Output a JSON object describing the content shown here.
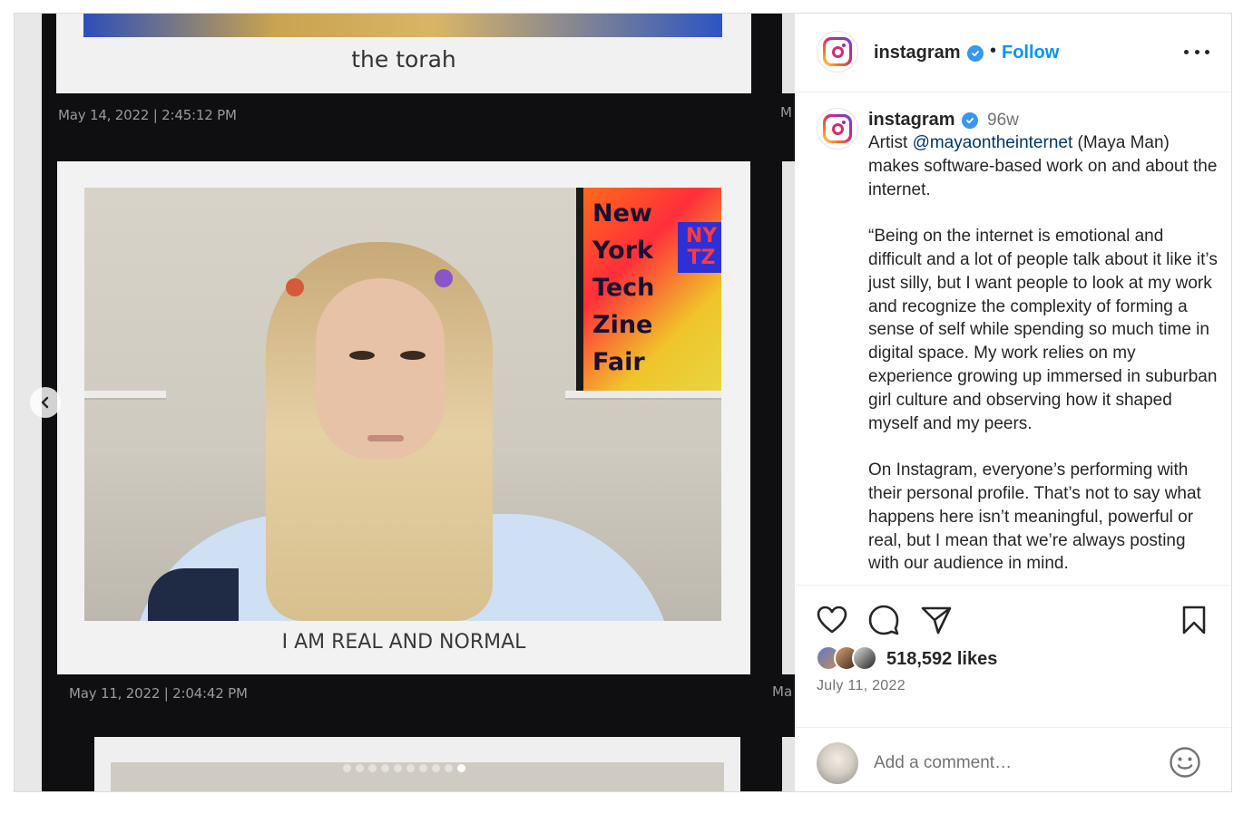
{
  "media": {
    "top_caption": "the torah",
    "timestamp_1": "May 14, 2022 | 2:45:12 PM",
    "cut_label_1": "M",
    "poster_text": "New\nYork\nTech\nZine\nFair",
    "poster_badge": "NY\nTZ",
    "main_caption": "I AM REAL AND NORMAL",
    "timestamp_2": "May 11, 2022 | 2:04:42 PM",
    "cut_label_2": "Ma",
    "prev_icon": "chevron-left-icon",
    "slide_count": 10,
    "active_slide": 10
  },
  "header": {
    "username": "instagram",
    "separator": "•",
    "follow_label": "Follow",
    "more_icon": "more-horizontal-icon"
  },
  "caption": {
    "username": "instagram",
    "time_ago": "96w",
    "text_before_mention": "Artist ",
    "mention": "@mayaontheinternet",
    "text_after_mention": " (Maya Man) makes software-based work on and about the internet.\n\n“Being on the internet is emotional and difficult and a lot of people talk about it like it’s just silly, but I want people to look at my work and recognize the complexity of forming a sense of self while spending so much time in digital space. My work relies on my experience growing up immersed in suburban girl culture and observing how it shaped myself and my peers.\n\nOn Instagram, everyone’s performing with their personal profile. That’s not to say what happens here isn’t meaningful, powerful or real, but I mean that we’re always posting with our audience in mind."
  },
  "actions": {
    "like_icon": "heart-icon",
    "comment_icon": "comment-icon",
    "share_icon": "share-icon",
    "save_icon": "bookmark-icon",
    "likes_text": "518,592 likes",
    "date": "July 11, 2022"
  },
  "comment": {
    "placeholder": "Add a comment…",
    "emoji_icon": "smile-icon"
  },
  "colors": {
    "accent": "#0095f6",
    "verified": "#3897f0",
    "mention": "#00376b",
    "muted": "#737373"
  }
}
